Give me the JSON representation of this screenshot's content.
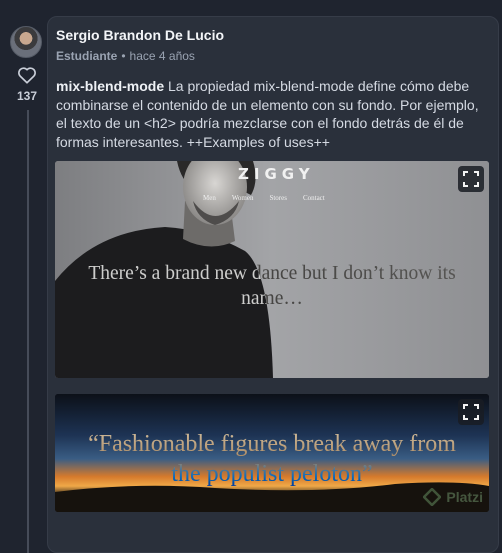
{
  "post": {
    "author": "Sergio Brandon De Lucio",
    "role": "Estudiante",
    "time": "hace 4 años",
    "likes": "137",
    "keyword": "mix-blend-mode",
    "text": " La propiedad mix-blend-mode define cómo debe combinarse el contenido de un elemento con su fondo. Por ejemplo, el texto de un <h2> podría mezclarse con el fondo detrás de él de formas interesantes. ++Examples of uses++"
  },
  "example1": {
    "brand": "ZIGGY",
    "nav": [
      "Men",
      "Women",
      "Stores",
      "Contact"
    ],
    "heading_line1": "There’s a brand new dance but I don’t know its",
    "heading_line2": "name…"
  },
  "example2": {
    "quote_line1": "“Fashionable figures break away from",
    "quote_line2": "the populist peloton”",
    "watermark": "Platzi"
  }
}
